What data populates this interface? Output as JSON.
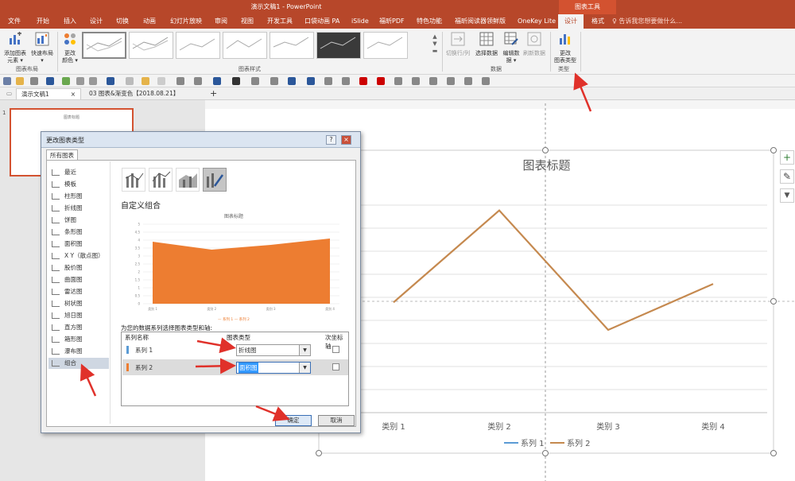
{
  "app": {
    "window_title": "演示文稿1 - PowerPoint",
    "context_group": "图表工具"
  },
  "tabs": [
    "文件",
    "开始",
    "插入",
    "设计",
    "切换",
    "动画",
    "幻灯片放映",
    "审阅",
    "视图",
    "开发工具",
    "口袋动画 PA",
    "iSlide",
    "福昕PDF",
    "特色功能",
    "福昕阅读器领鲜版",
    "OneKey Lite",
    "设计",
    "格式"
  ],
  "tell_me": "告诉我您想要做什么...",
  "ribbon": {
    "add_element": "添加图表\n元素 ▾",
    "quick_layout": "快速布局\n▾",
    "change_color": "更改\n颜色 ▾",
    "switch_rowcol": "切换行/列",
    "select_data": "选择数据",
    "edit_data": "编辑数\n据 ▾",
    "refresh_data": "刷新数据",
    "change_type": "更改\n图表类型",
    "group_layout": "图表布局",
    "group_styles": "图表样式",
    "group_data": "数据",
    "group_type": "类型"
  },
  "doc_tabs": [
    {
      "label": "演示文稿1"
    },
    {
      "label": "03 图表&渐变色【2018.08.21】"
    }
  ],
  "doc_tab_close": "×",
  "doc_tab_add": "+",
  "thumb": {
    "number": "1",
    "mini_title": "图表标题"
  },
  "side_buttons": {
    "add": "+",
    "style": "✎",
    "filter": "▼"
  },
  "main_chart": {
    "title": "图表标题",
    "categories": [
      "类别 1",
      "类别 2",
      "类别 3",
      "类别 4"
    ],
    "legend": [
      "系列 1",
      "系列 2"
    ],
    "colors": {
      "series1": "#5b9bd5",
      "series2": "#c5894f"
    }
  },
  "dialog": {
    "title": "更改图表类型",
    "help": "?",
    "close": "×",
    "tab": "所有图表",
    "types": [
      "最近",
      "模板",
      "柱形图",
      "折线图",
      "饼图",
      "条形图",
      "面积图",
      "X Y（散点图）",
      "股价图",
      "曲面图",
      "雷达图",
      "树状图",
      "旭日图",
      "直方图",
      "箱形图",
      "瀑布图",
      "组合"
    ],
    "subtype_title": "自定义组合",
    "preview_title": "图表标题",
    "preview_legend": "— 系列 1  — 系列 2",
    "preview_yticks": [
      "5",
      "4.5",
      "4",
      "3.5",
      "3",
      "2.5",
      "2",
      "1.5",
      "1",
      "0.5",
      "0"
    ],
    "preview_xticks": [
      "类别 1",
      "类别 2",
      "类别 3",
      "类别 4"
    ],
    "series_prompt": "为您的数据系列选择图表类型和轴:",
    "col_name": "系列名称",
    "col_type": "图表类型",
    "col_axis": "次坐标轴",
    "rows": [
      {
        "name": "系列 1",
        "type": "折线图",
        "color": "#5b9bd5"
      },
      {
        "name": "系列 2",
        "type": "面积图",
        "color": "#ed7d31"
      }
    ],
    "ok": "确定",
    "cancel": "取消"
  },
  "chart_data": [
    {
      "type": "line",
      "title": "图表标题",
      "categories": [
        "类别 1",
        "类别 2",
        "类别 3",
        "类别 4"
      ],
      "series": [
        {
          "name": "系列 2",
          "values": [
            2.4,
            4.4,
            1.8,
            2.8
          ]
        }
      ]
    },
    {
      "type": "area",
      "title": "图表标题",
      "categories": [
        "类别 1",
        "类别 2",
        "类别 3",
        "类别 4"
      ],
      "ylim": [
        0,
        5
      ],
      "series": [
        {
          "name": "系列 2",
          "values": [
            3.9,
            3.4,
            3.7,
            4.1
          ]
        }
      ]
    }
  ]
}
